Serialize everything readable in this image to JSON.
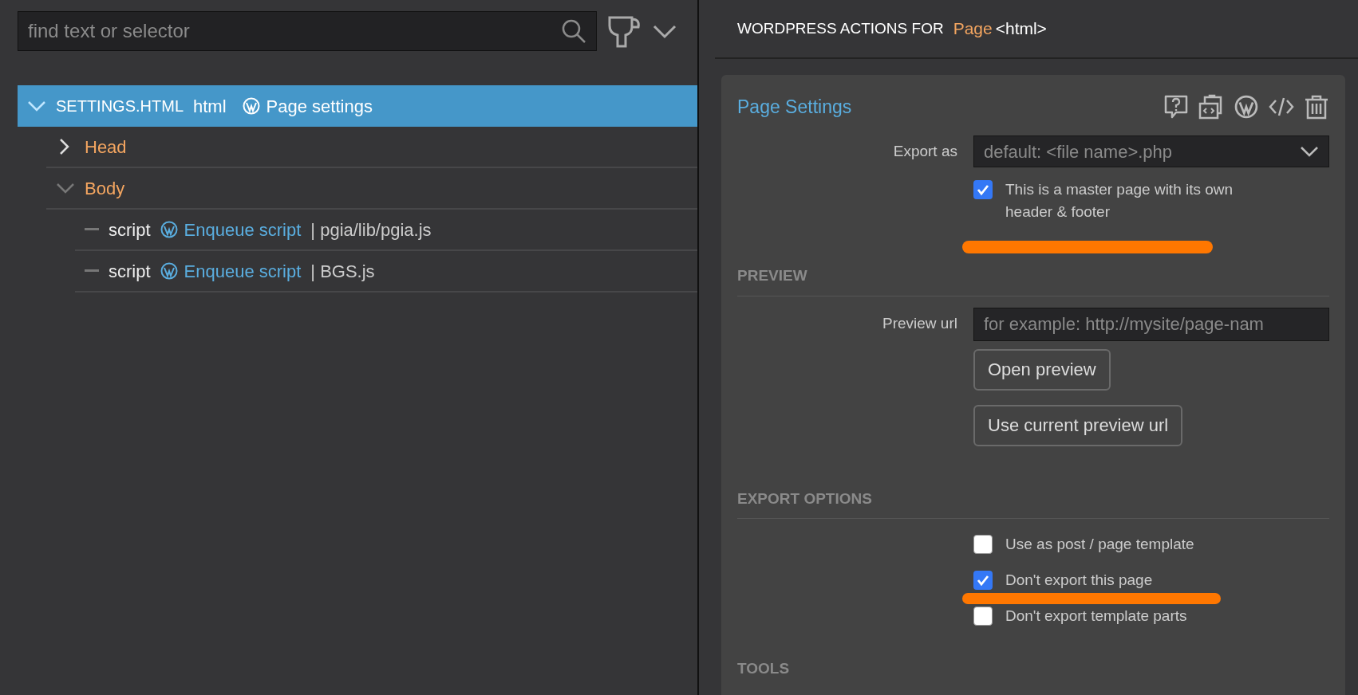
{
  "search": {
    "placeholder": "find text or selector"
  },
  "tree": [
    {
      "kind": "file",
      "file": "SETTINGS.HTML",
      "element": "html",
      "action": "Page settings",
      "selected": true,
      "expanded": true,
      "children": [
        {
          "kind": "section",
          "label": "Head",
          "selected": false,
          "expanded": false
        },
        {
          "kind": "section",
          "label": "Body",
          "selected": false,
          "expanded": true,
          "children": [
            {
              "kind": "element",
              "element": "script",
              "action": "Enqueue script",
              "detail": "| pgia/lib/pgia.js",
              "selected": false
            },
            {
              "kind": "element",
              "element": "script",
              "action": "Enqueue script",
              "detail": "| BGS.js",
              "selected": false
            }
          ]
        }
      ]
    }
  ],
  "actions_header": {
    "prefix": "WORDPRESS ACTIONS FOR",
    "target": "Page",
    "tag": "<html>"
  },
  "card": {
    "title": "Page Settings",
    "export_as": {
      "label": "Export as",
      "placeholder": "default: <file name>.php"
    },
    "master_page": {
      "label": "This is a master page with its own header & footer",
      "checked": true
    },
    "preview": {
      "heading": "PREVIEW",
      "url_label": "Preview url",
      "url_placeholder": "for example: http://mysite/page-nam",
      "buttons": [
        "Open preview",
        "Use current preview url"
      ]
    },
    "export_options": {
      "heading": "EXPORT OPTIONS",
      "options": [
        {
          "label": "Use as post / page template",
          "checked": false
        },
        {
          "label": "Don't export this page",
          "checked": true
        },
        {
          "label": "Don't export template parts",
          "checked": false
        }
      ]
    },
    "tools": {
      "heading": "TOOLS"
    }
  }
}
